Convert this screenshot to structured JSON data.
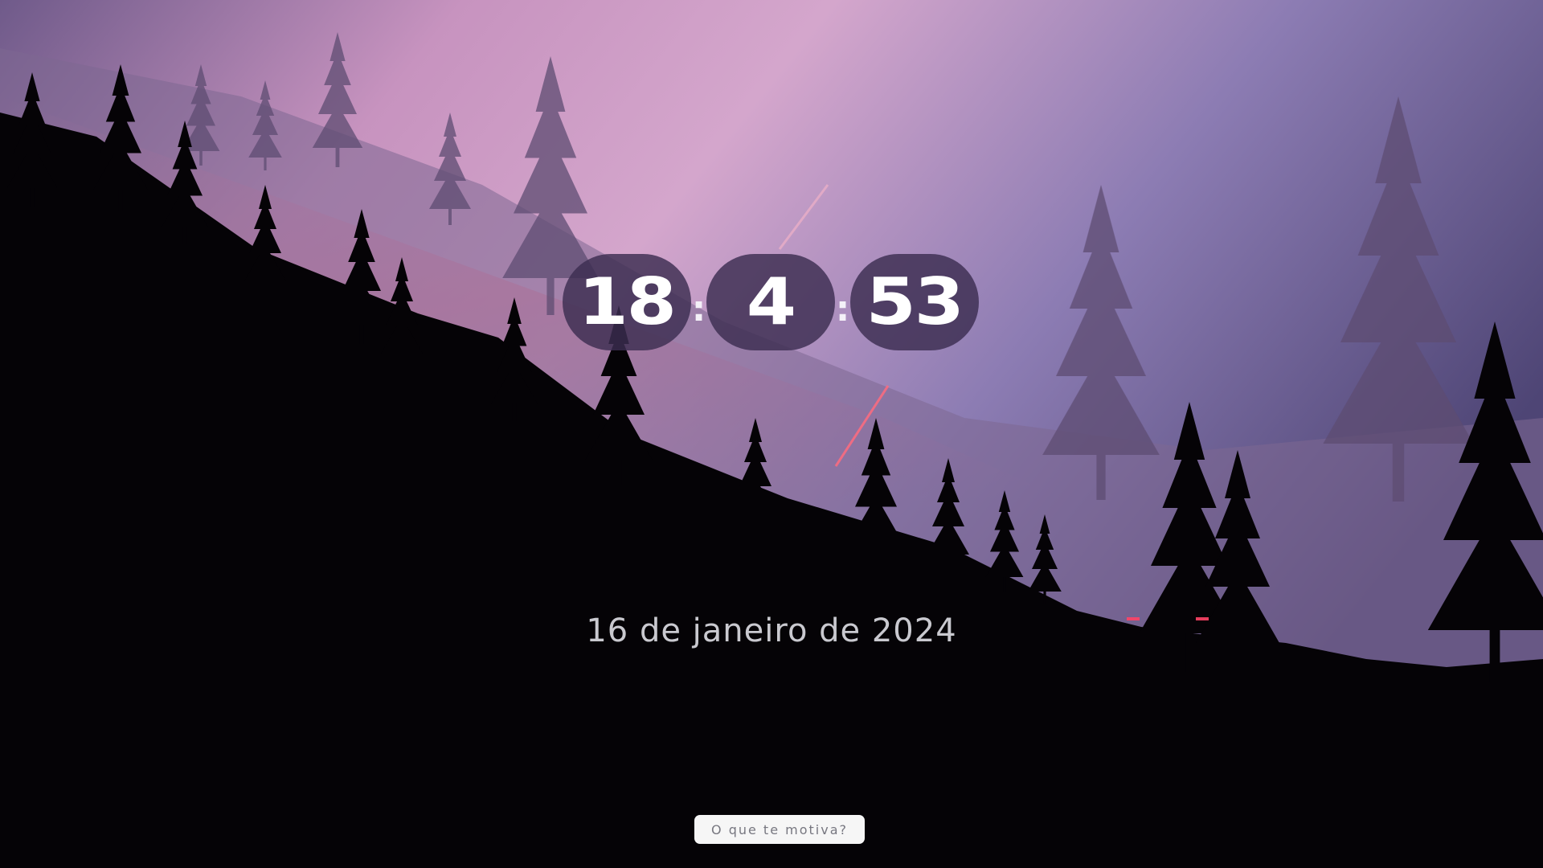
{
  "clock": {
    "hours": "18",
    "minutes": "4",
    "seconds": "53",
    "separator": ":"
  },
  "date": "16 de janeiro de 2024",
  "motivation_button": {
    "label": "O que te motiva?"
  },
  "background": {
    "scene": "forest-sunset-wallpaper",
    "colors": {
      "sky_top": "#5e527f",
      "sky_pink": "#d69ec2",
      "sky_violet": "#8f7fb5",
      "silhouette": "#000000"
    }
  }
}
